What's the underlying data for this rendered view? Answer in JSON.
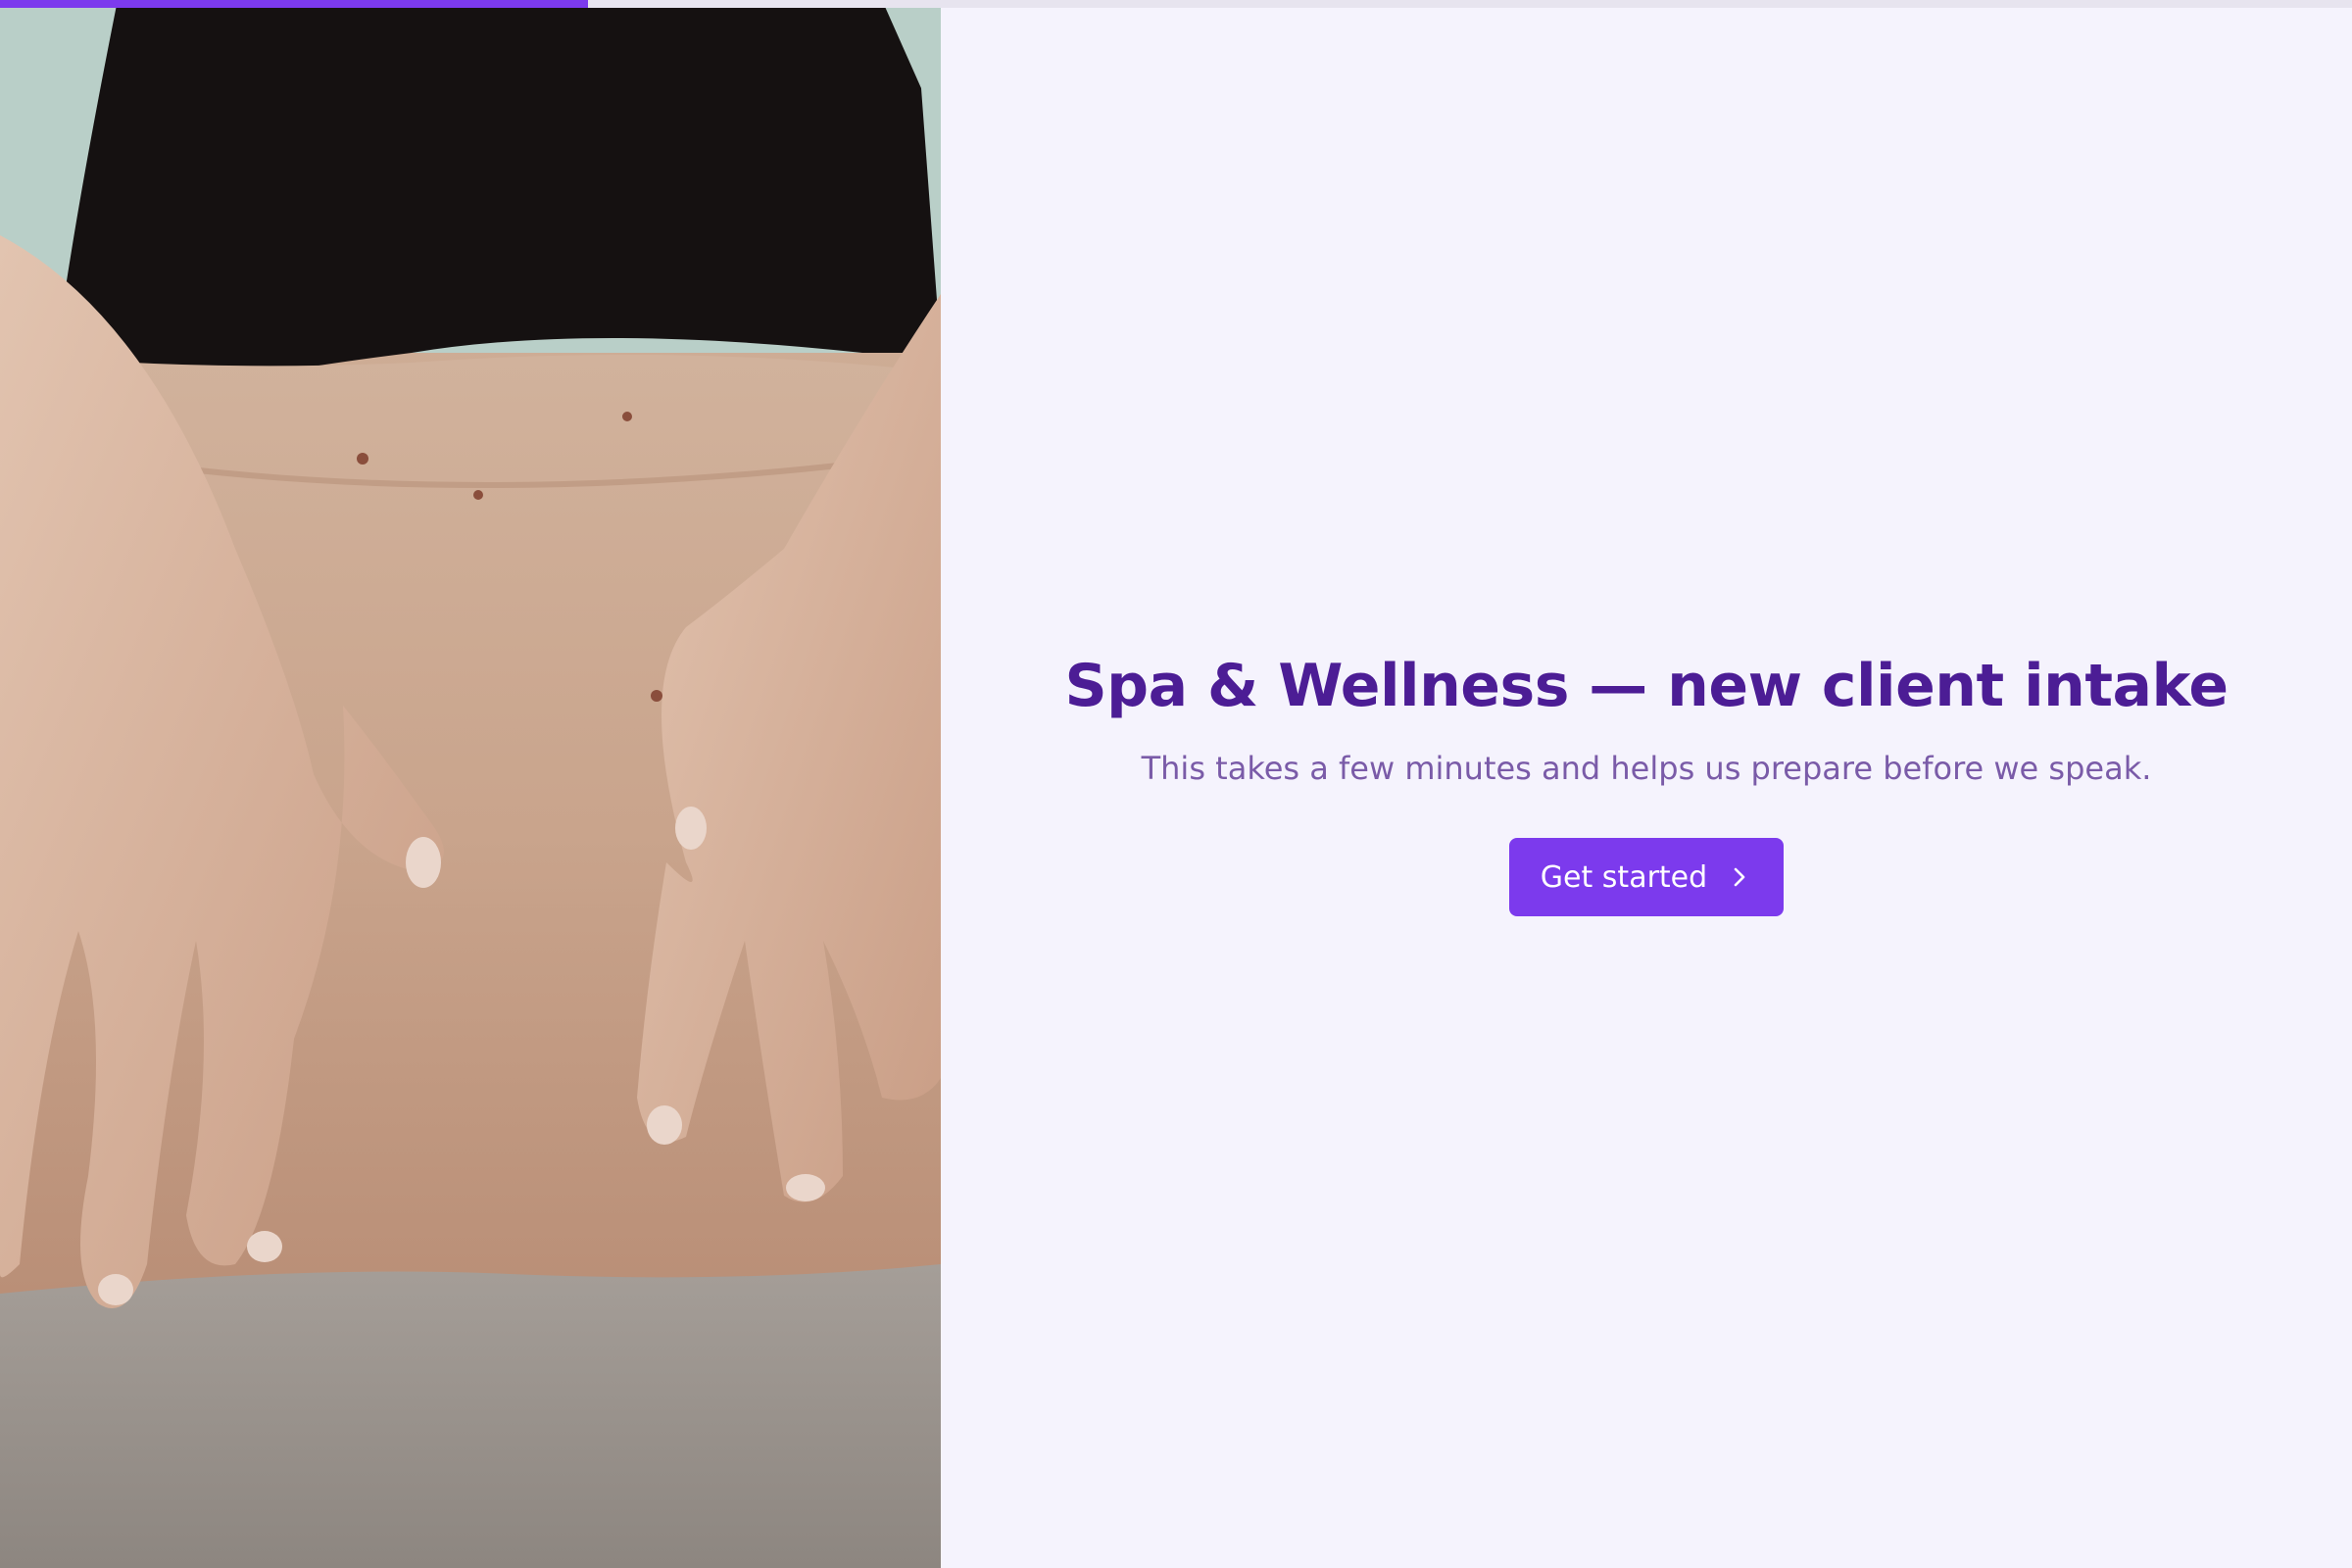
{
  "progress": {
    "value": 0.25,
    "color": "#7c3aed",
    "track": "#e7e4ef"
  },
  "hero": {
    "image_icon": "massage-photo",
    "image_alt": "Massage therapy photo"
  },
  "intro": {
    "title": "Spa & Wellness — new client intake",
    "subtitle": "This takes a few minutes and helps us prepare before we speak.",
    "button_label": "Get started",
    "button_icon": "chevron-right-icon"
  },
  "colors": {
    "accent": "#7c3aed",
    "title": "#4c1d95",
    "subtitle": "#7a5ba8",
    "background": "#f5f3fd"
  }
}
